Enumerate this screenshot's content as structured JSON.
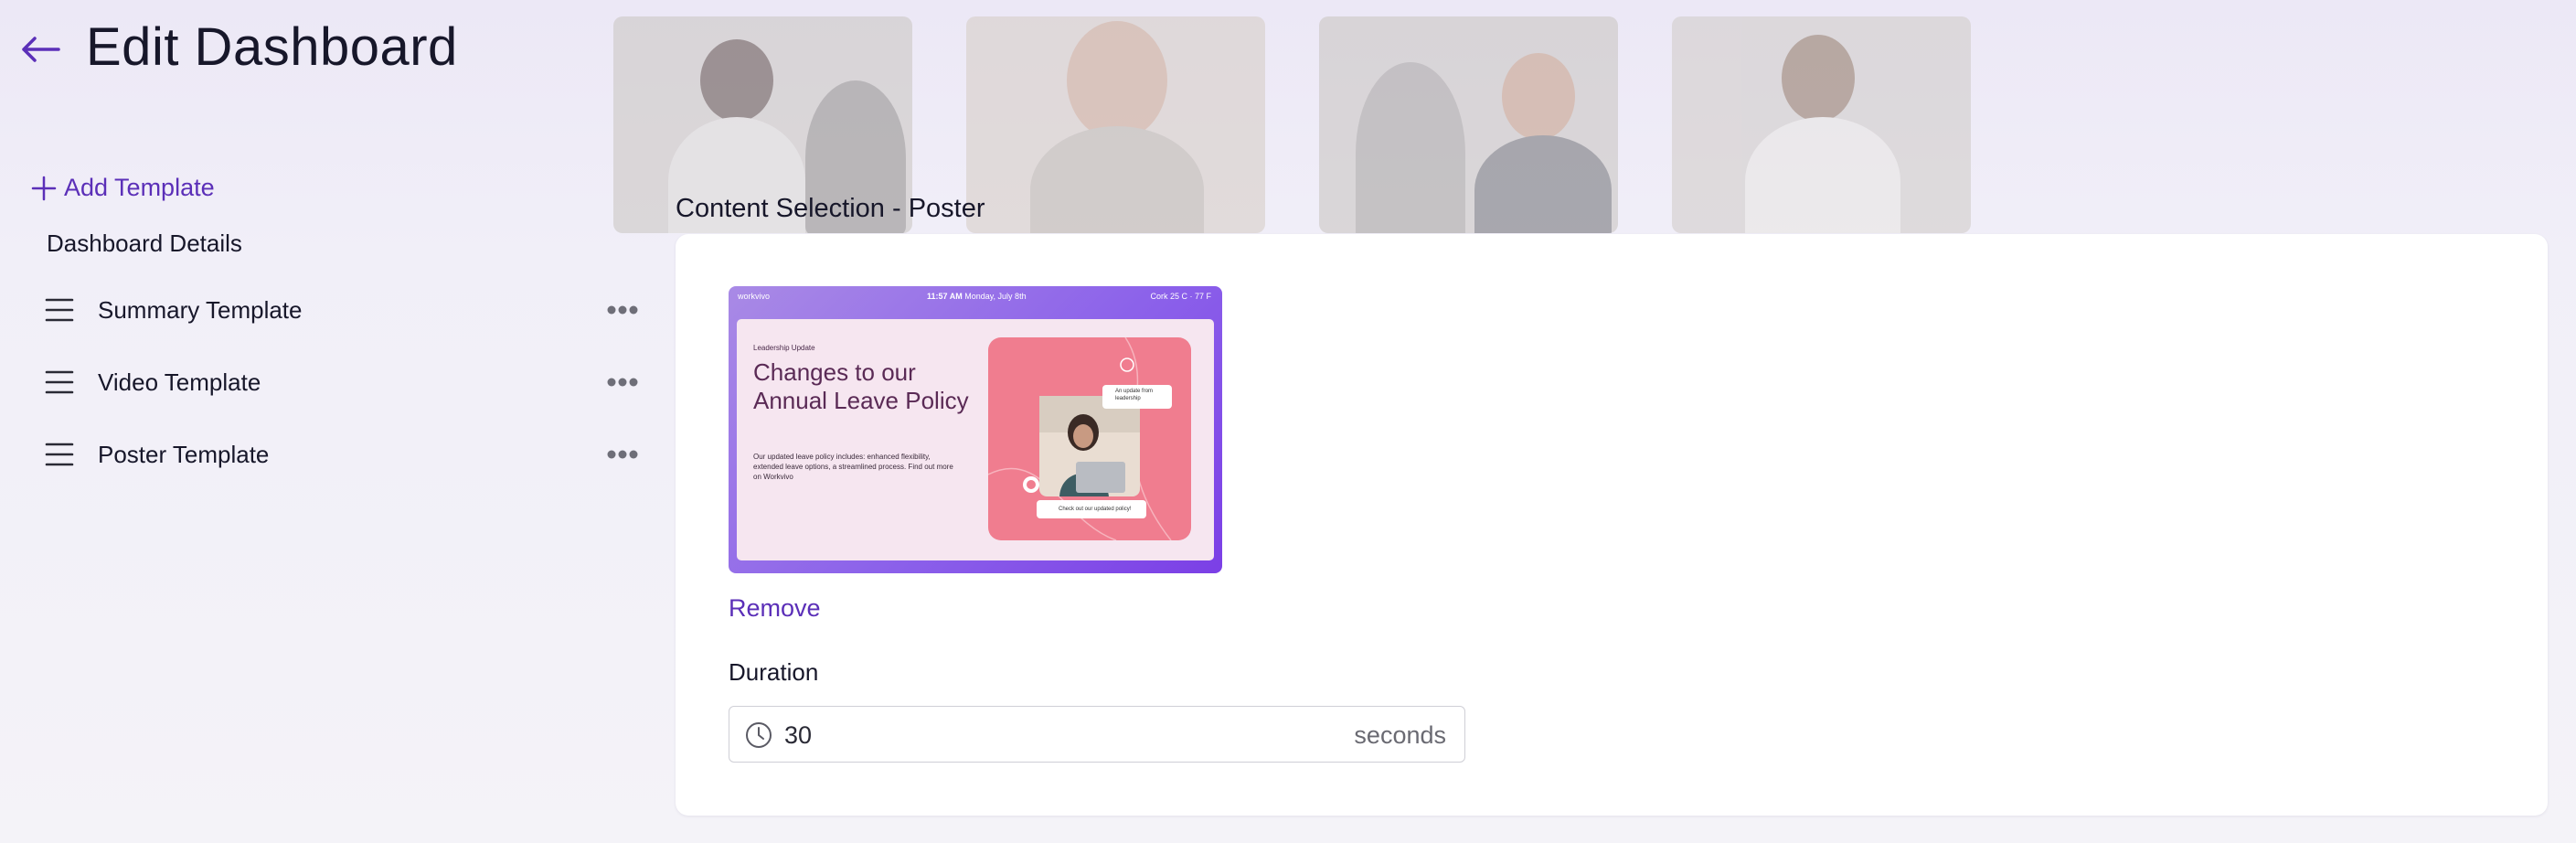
{
  "header": {
    "title": "Edit Dashboard"
  },
  "sidebar": {
    "add_template_label": "Add Template",
    "details_heading": "Dashboard Details",
    "templates": [
      {
        "label": "Summary Template"
      },
      {
        "label": "Video Template"
      },
      {
        "label": "Poster Template"
      }
    ]
  },
  "content": {
    "section_title": "Content Selection - Poster",
    "poster": {
      "brand": "workvivo",
      "time": "11:57 AM",
      "date": "Monday, July 8th",
      "weather": "Cork 25 C · 77 F",
      "kicker": "Leadership Update",
      "headline": "Changes to our Annual Leave Policy",
      "body": "Our updated leave policy includes: enhanced flexibility, extended leave options, a streamlined process. Find out more on Workvivo",
      "chip_top": "An update from leadership",
      "chip_bottom": "Check out our updated policy!"
    },
    "remove_label": "Remove",
    "duration": {
      "label": "Duration",
      "value": "30",
      "suffix": "seconds"
    }
  },
  "colors": {
    "accent": "#5b2fb8",
    "poster_gradient_start": "#a98ae6",
    "poster_gradient_end": "#7b3fe6",
    "poster_pink": "#f07d8f",
    "card_bg": "#ffffff"
  }
}
